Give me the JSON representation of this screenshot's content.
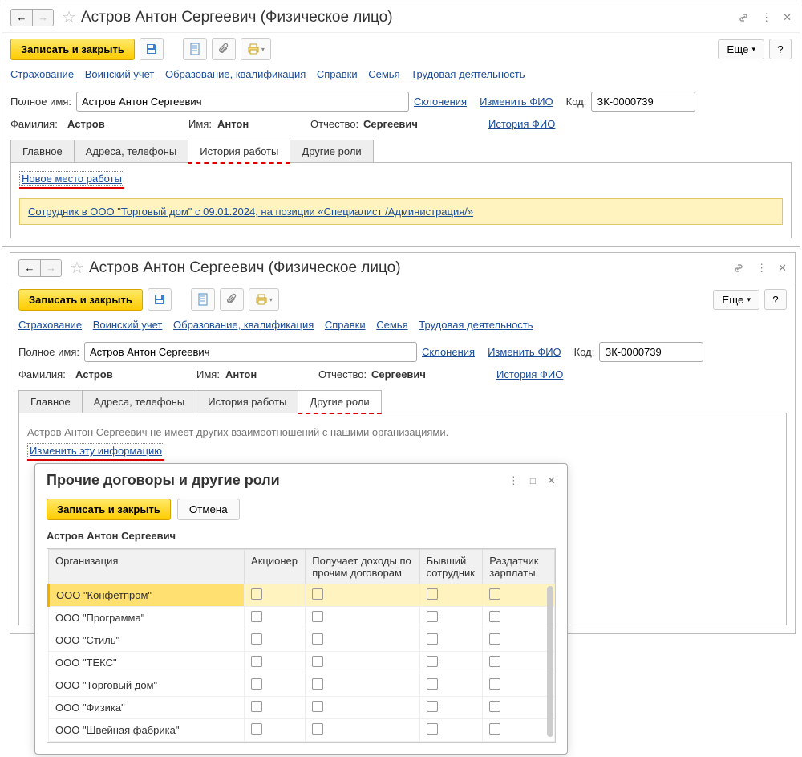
{
  "title": "Астров Антон Сергеевич (Физическое лицо)",
  "toolbar": {
    "save_close": "Записать и закрыть",
    "more": "Еще"
  },
  "links": {
    "insurance": "Страхование",
    "military": "Воинский учет",
    "education": "Образование, квалификация",
    "certs": "Справки",
    "family": "Семья",
    "work": "Трудовая деятельность"
  },
  "form": {
    "fullname_label": "Полное имя:",
    "fullname_value": "Астров Антон Сергеевич",
    "declension": "Склонения",
    "edit_fio": "Изменить ФИО",
    "code_label": "Код:",
    "code_value": "ЗК-0000739",
    "surname_label": "Фамилия:",
    "surname_value": "Астров",
    "name_label": "Имя:",
    "name_value": "Антон",
    "patronymic_label": "Отчество:",
    "patronymic_value": "Сергеевич",
    "fio_history": "История ФИО"
  },
  "tabs": {
    "main": "Главное",
    "addresses": "Адреса, телефоны",
    "history": "История работы",
    "roles": "Другие роли"
  },
  "w1": {
    "new_place": "Новое место работы",
    "employee_info": "Сотрудник в ООО \"Торговый дом\" с 09.01.2024, на позиции «Специалист /Администрация/»"
  },
  "w2": {
    "no_rel": "Астров Антон Сергеевич не имеет других взаимоотношений с нашими организациями.",
    "change_info": "Изменить эту информацию"
  },
  "dialog": {
    "title": "Прочие договоры и другие роли",
    "save_close": "Записать и закрыть",
    "cancel": "Отмена",
    "person": "Астров Антон Сергеевич",
    "cols": {
      "org": "Организация",
      "shareholder": "Акционер",
      "income": "Получает доходы по прочим договорам",
      "former": "Бывший сотрудник",
      "payer": "Раздатчик зарплаты"
    },
    "rows": [
      "ООО \"Конфетпром\"",
      "ООО \"Программа\"",
      "ООО \"Стиль\"",
      "ООО \"ТЕКС\"",
      "ООО \"Торговый дом\"",
      "ООО \"Физика\"",
      "ООО \"Швейная фабрика\""
    ]
  }
}
